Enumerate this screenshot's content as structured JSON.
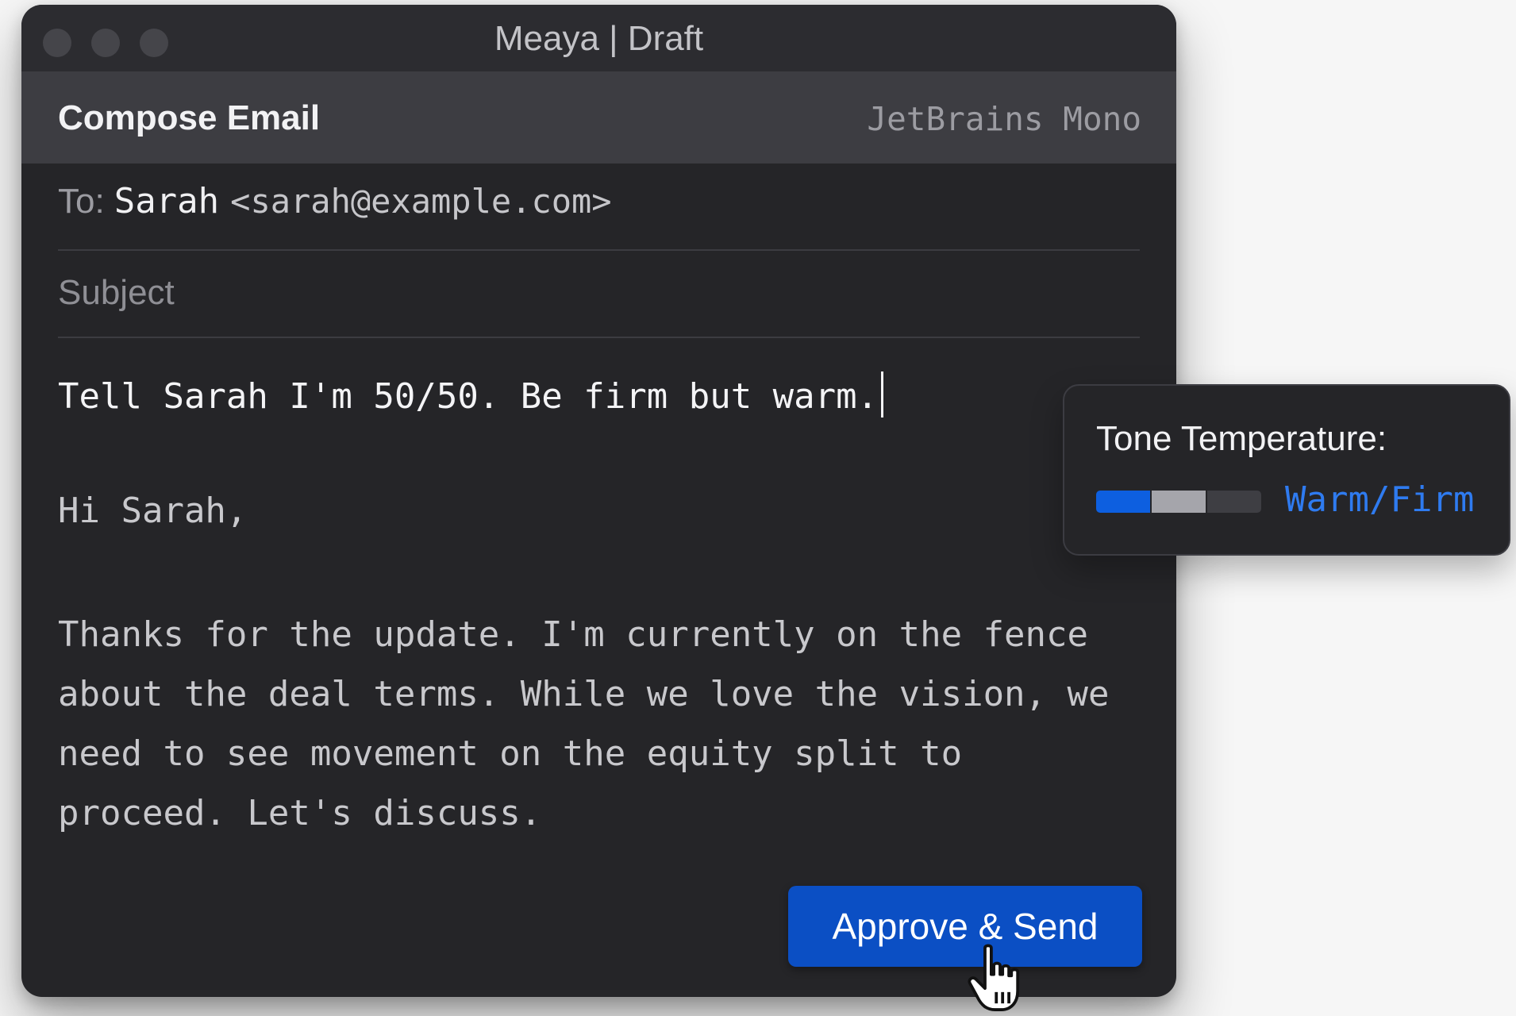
{
  "window": {
    "title": "Meaya | Draft"
  },
  "toolbar": {
    "title": "Compose Email",
    "font_name": "JetBrains Mono"
  },
  "email": {
    "to_label": "To:",
    "to_name": "Sarah",
    "to_address": "<sarah@example.com>",
    "subject_placeholder": "Subject",
    "prompt": "Tell Sarah I'm 50/50. Be firm but warm.",
    "greeting": "Hi Sarah,",
    "body_lines": [
      "Thanks for the update. I'm currently on the fence",
      "about the deal terms. While we love the vision, we",
      "need to see movement on the equity split to",
      "proceed. Let's discuss."
    ]
  },
  "actions": {
    "approve_label": "Approve & Send"
  },
  "tone": {
    "label": "Tone Temperature:",
    "value": "Warm/Firm",
    "meter_segments": 3,
    "meter_colors": [
      "#0d5fe0",
      "#a5a5ab",
      "#3e3e43"
    ]
  },
  "colors": {
    "accent": "#0b4fc4",
    "tone_value": "#2f7bf0",
    "window_bg": "#252528",
    "toolbar_bg": "#3d3d42"
  },
  "icons": {
    "cursor": "hand-pointer-icon",
    "traffic_lights": [
      "close-button",
      "minimize-button",
      "zoom-button"
    ]
  }
}
